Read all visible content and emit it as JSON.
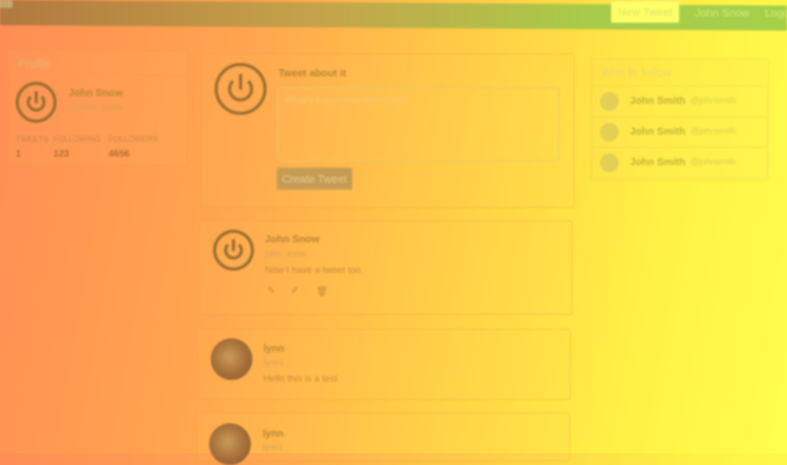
{
  "navbar": {
    "new_tweet_label": "New Tweet",
    "user_link": "John Snow",
    "logout_link": "Logout"
  },
  "profile": {
    "heading": "Profile",
    "name": "John Snow",
    "handle": "@john_snow",
    "stats": [
      {
        "label": "TWEETS",
        "value": "1"
      },
      {
        "label": "FOLLOWING",
        "value": "123"
      },
      {
        "label": "FOLLOWERS",
        "value": "4656"
      }
    ]
  },
  "compose": {
    "heading": "Tweet about it",
    "placeholder": "What's happening right now?",
    "button_label": "Create Tweet"
  },
  "tweets": [
    {
      "name": "John Snow",
      "handle": "john_snow",
      "text": "Now I have a tweet too"
    },
    {
      "name": "lynn",
      "handle": "lynn1",
      "text": "Hello this is a test"
    },
    {
      "name": "lynn",
      "handle": "lynn1",
      "text": ""
    }
  ],
  "who_to_follow": {
    "heading": "Who to follow",
    "items": [
      {
        "name": "John Smith",
        "handle": "@johnsmith"
      },
      {
        "name": "John Smith",
        "handle": "@johnsmith"
      },
      {
        "name": "John Smith",
        "handle": "@johnsmith"
      }
    ]
  },
  "colors": {
    "accent_navbar": "#a6d04a",
    "new_tweet_button": "#ffff66"
  }
}
